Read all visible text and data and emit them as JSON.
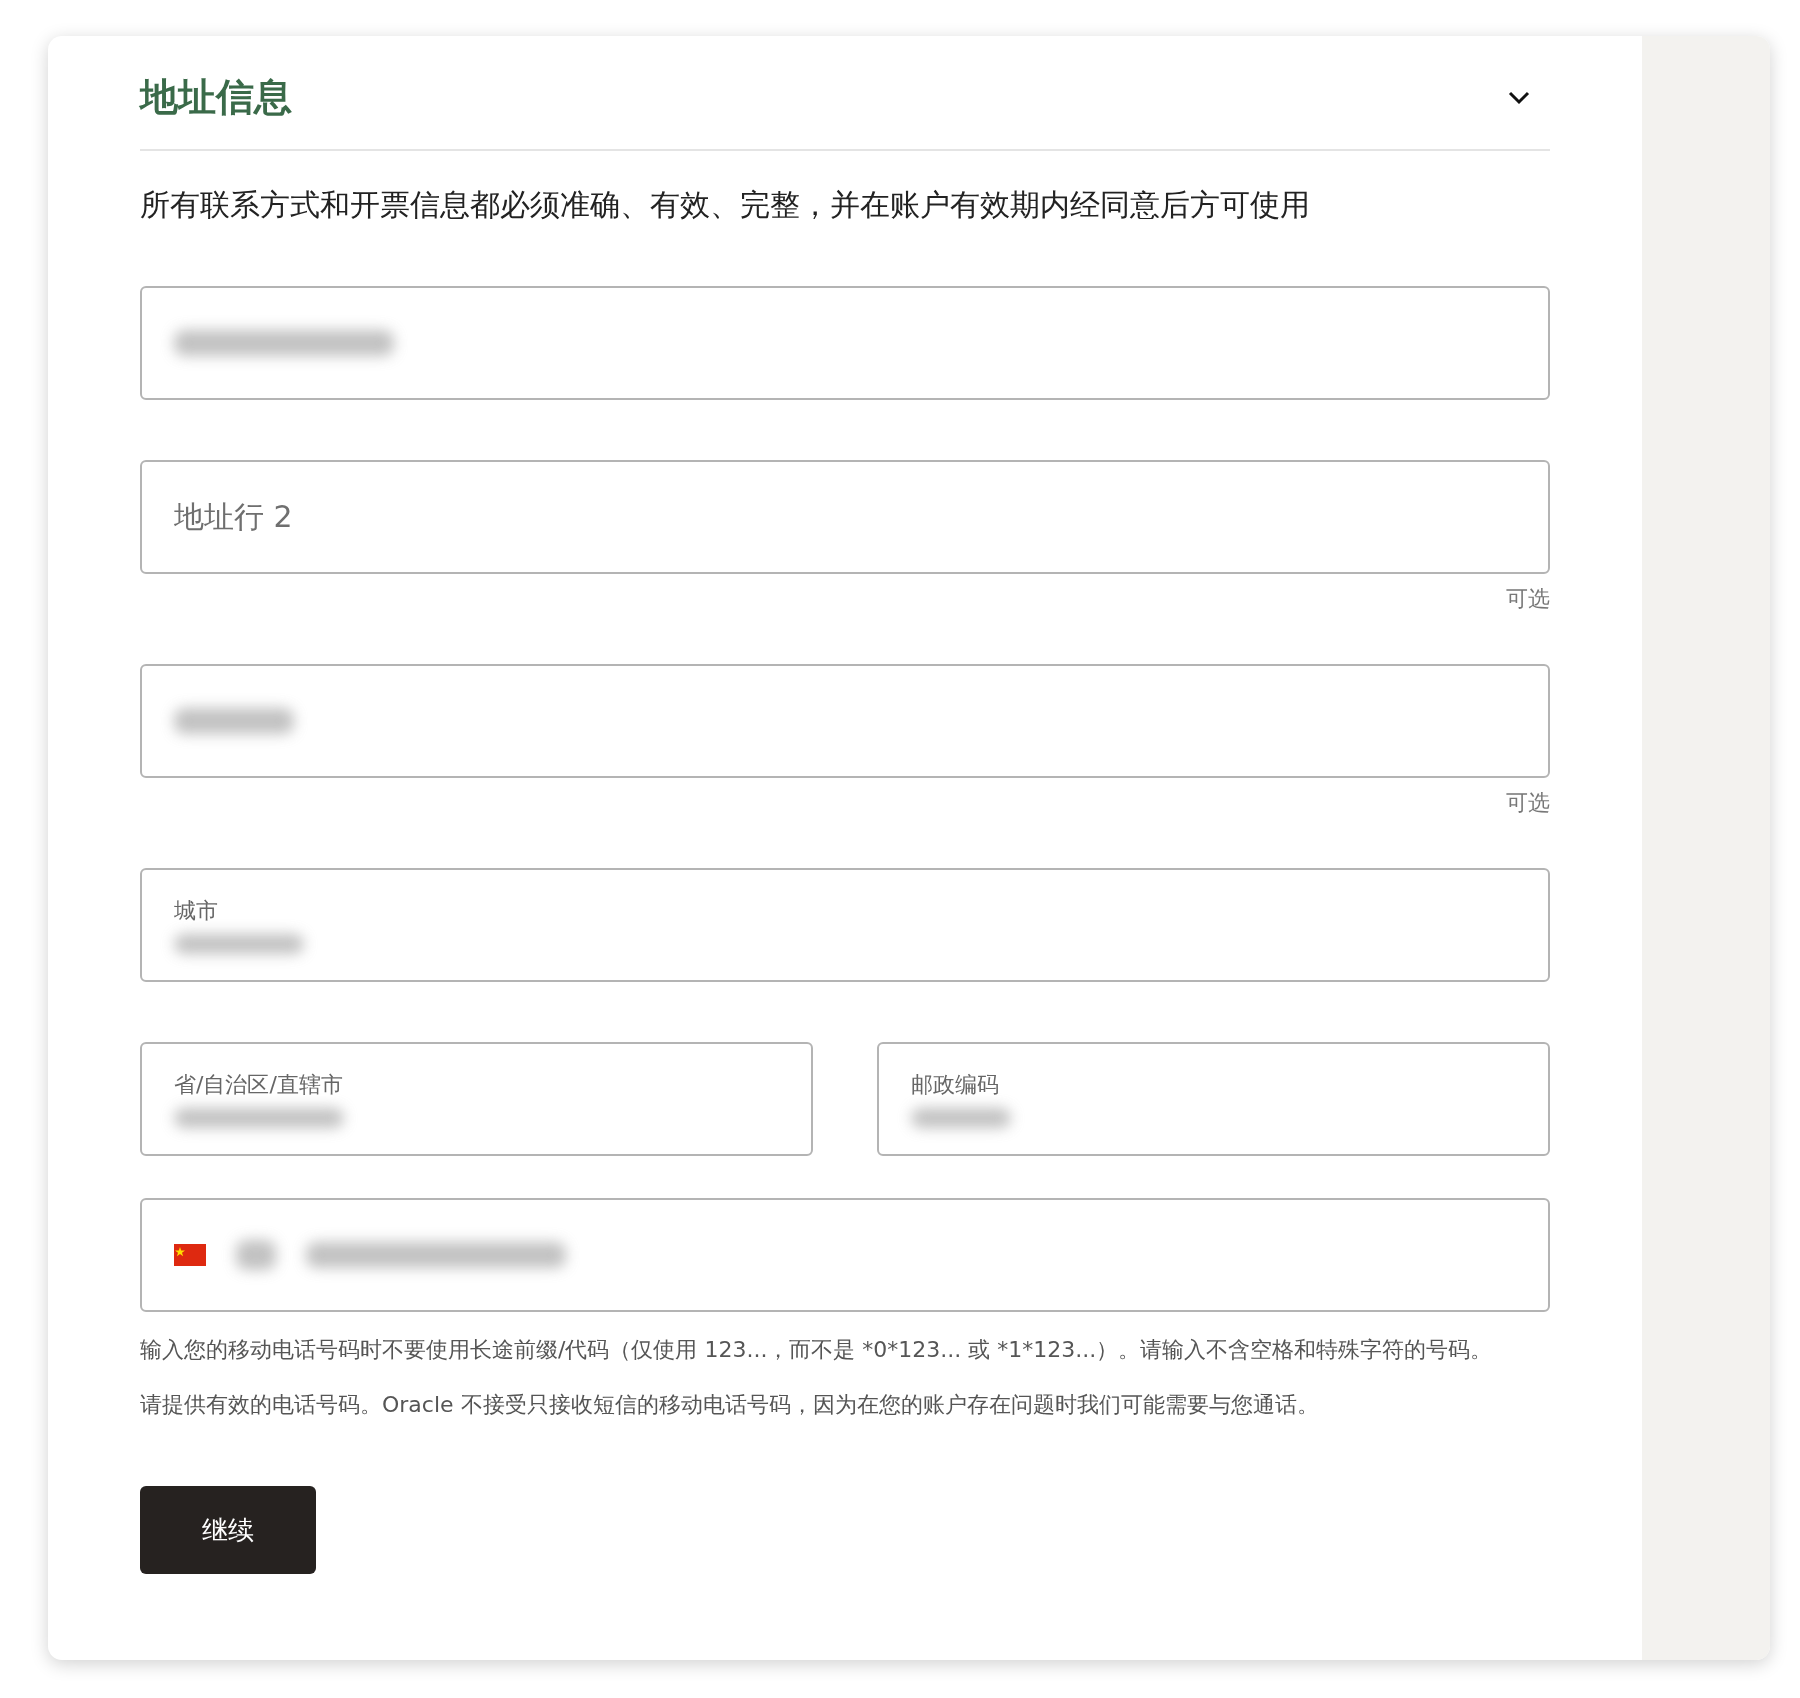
{
  "section": {
    "title": "地址信息",
    "expanded": true
  },
  "notice": "所有联系方式和开票信息都必须准确、有效、完整，并在账户有效期内经同意后方可使用",
  "fields": [
    {
      "kind": "redacted"
    },
    {
      "kind": "placeholder",
      "placeholder": "地址行 2",
      "hint": "可选"
    },
    {
      "kind": "redacted",
      "hint": "可选"
    },
    {
      "kind": "labeled",
      "label": "城市"
    }
  ],
  "pair": [
    {
      "label": "省/自治区/直辖市"
    },
    {
      "label": "邮政编码"
    }
  ],
  "phone": {
    "kind": "phone"
  },
  "help": [
    "输入您的移动电话号码时不要使用长途前缀/代码（仅使用 123...，而不是 *0*123... 或 *1*123...）。请输入不含空格和特殊字符的号码。",
    "请提供有效的电话号码。Oracle 不接受只接收短信的移动电话号码，因为在您的账户存在问题时我们可能需要与您通话。"
  ],
  "button": "继续"
}
